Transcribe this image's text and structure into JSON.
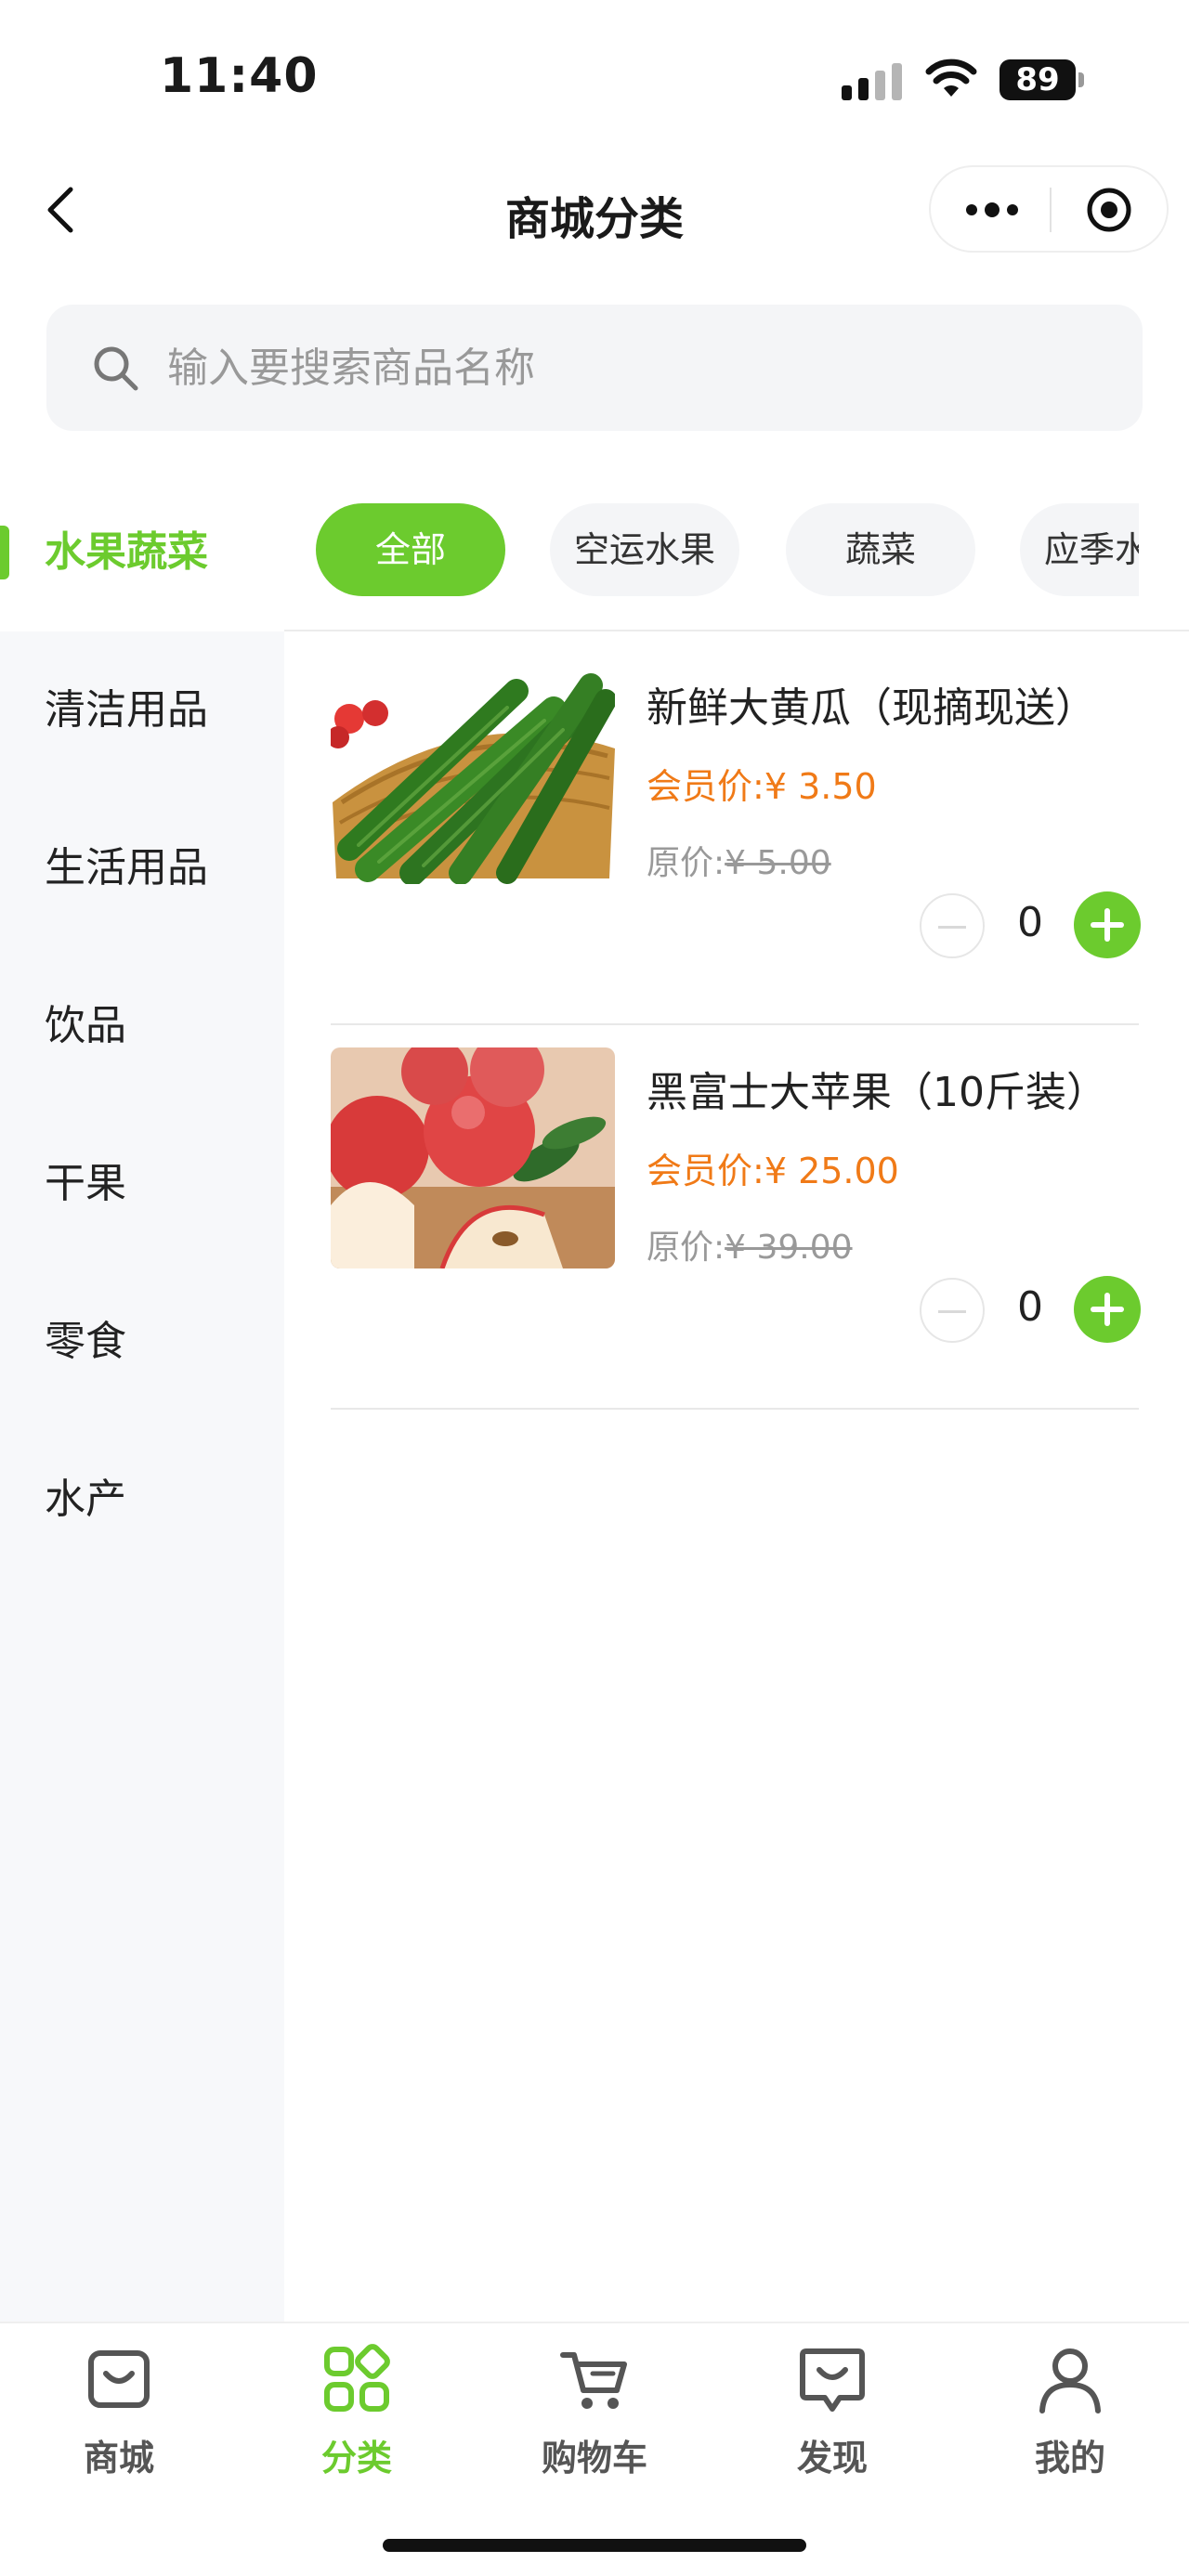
{
  "status_bar": {
    "time": "11:40",
    "battery": "89"
  },
  "nav": {
    "title": "商城分类"
  },
  "search": {
    "placeholder": "输入要搜索商品名称"
  },
  "sidebar": {
    "items": [
      {
        "label": "水果蔬菜",
        "active": true
      },
      {
        "label": "清洁用品"
      },
      {
        "label": "生活用品"
      },
      {
        "label": "饮品"
      },
      {
        "label": "干果"
      },
      {
        "label": "零食"
      },
      {
        "label": "水产"
      }
    ]
  },
  "chips": [
    {
      "label": "全部",
      "active": true
    },
    {
      "label": "空运水果"
    },
    {
      "label": "蔬菜"
    },
    {
      "label": "应季水果"
    }
  ],
  "products": [
    {
      "name": "新鲜大黄瓜（现摘现送）",
      "member_price_label": "会员价:",
      "member_price": "¥ 3.50",
      "original_price_label": "原价:",
      "original_price": "¥ 5.00",
      "quantity": "0",
      "image": "cucumber-photo"
    },
    {
      "name": "黑富士大苹果（10斤装）",
      "member_price_label": "会员价:",
      "member_price": "¥ 25.00",
      "original_price_label": "原价:",
      "original_price": "¥ 39.00",
      "quantity": "0",
      "image": "apple-photo"
    }
  ],
  "tabbar": {
    "items": [
      {
        "label": "商城",
        "icon": "shopping-bag-icon"
      },
      {
        "label": "分类",
        "icon": "category-grid-icon",
        "active": true
      },
      {
        "label": "购物车",
        "icon": "cart-icon"
      },
      {
        "label": "发现",
        "icon": "discover-icon"
      },
      {
        "label": "我的",
        "icon": "user-icon"
      }
    ]
  },
  "colors": {
    "accent": "#6ccb2e",
    "price": "#f07a17",
    "muted": "#999999"
  }
}
